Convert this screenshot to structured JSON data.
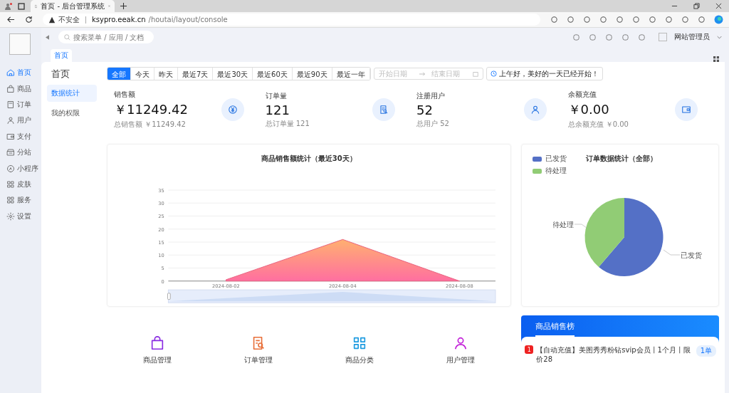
{
  "browser": {
    "tab_title": "首页 - 后台管理系统",
    "security": "不安全",
    "host": "ksypro.eeak.cn",
    "path": "/houtai/layout/console"
  },
  "header": {
    "search_placeholder": "搜索菜单 / 应用 / 文档",
    "user": "网站管理员"
  },
  "page_tabs": [
    {
      "label": "首页",
      "selected": true
    }
  ],
  "sidebar": [
    {
      "label": "首页",
      "kind": "home",
      "selected": true
    },
    {
      "label": "商品",
      "kind": "bag",
      "selected": false
    },
    {
      "label": "订单",
      "kind": "doc",
      "selected": false
    },
    {
      "label": "用户",
      "kind": "user",
      "selected": false
    },
    {
      "label": "支付",
      "kind": "wallet",
      "selected": false
    },
    {
      "label": "分站",
      "kind": "store",
      "selected": false
    },
    {
      "label": "小程序",
      "kind": "mini",
      "selected": false
    },
    {
      "label": "皮肤",
      "kind": "grid",
      "selected": false
    },
    {
      "label": "服务",
      "kind": "grid",
      "selected": false
    },
    {
      "label": "设置",
      "kind": "gear",
      "selected": false
    }
  ],
  "page_title": "首页",
  "submenu": [
    {
      "label": "数据统计",
      "selected": true
    },
    {
      "label": "我的权限",
      "selected": false
    }
  ],
  "filters": [
    {
      "label": "全部",
      "selected": true
    },
    {
      "label": "今天",
      "selected": false
    },
    {
      "label": "昨天",
      "selected": false
    },
    {
      "label": "最近7天",
      "selected": false
    },
    {
      "label": "最近30天",
      "selected": false
    },
    {
      "label": "最近60天",
      "selected": false
    },
    {
      "label": "最近90天",
      "selected": false
    },
    {
      "label": "最近一年",
      "selected": false
    }
  ],
  "date_range": {
    "start_placeholder": "开始日期",
    "end_placeholder": "结束日期"
  },
  "greeting": "上午好，美好的一天已经开始！",
  "stats": [
    {
      "label": "销售额",
      "value": "￥11249.42",
      "sub": "总销售额 ￥11249.42",
      "kind": "yen"
    },
    {
      "label": "订单量",
      "value": "121",
      "sub": "总订单量 121",
      "kind": "order"
    },
    {
      "label": "注册用户",
      "value": "52",
      "sub": "总用户 52",
      "kind": "user"
    },
    {
      "label": "余额充值",
      "value": "￥0.00",
      "sub": "总余额充值 ￥0.00",
      "kind": "wallet"
    }
  ],
  "sales_chart": {
    "chart_data": {
      "type": "area",
      "title": "商品销售额统计（最近30天）",
      "categories": [
        "2024-08-02",
        "2024-08-04",
        "2024-08-08"
      ],
      "series": [
        {
          "color": "#e8607f",
          "values": [
            0.5,
            16,
            0
          ]
        }
      ],
      "grid": true,
      "ylim": [
        0,
        35
      ],
      "yticks": [
        0,
        5,
        10,
        15,
        20,
        25,
        30,
        35
      ]
    }
  },
  "order_chart": {
    "title": "订单数据统计（全部）",
    "legend": [
      {
        "label": "已发货",
        "color": "#5470c6"
      },
      {
        "label": "待处理",
        "color": "#91cc75"
      }
    ],
    "slice_labels": [
      "已发货",
      "待处理"
    ]
  },
  "quick_links": [
    {
      "label": "商品管理",
      "kind": "bag",
      "color": "#8a2be2"
    },
    {
      "label": "订单管理",
      "kind": "order",
      "color": "#e8703a"
    },
    {
      "label": "商品分类",
      "kind": "grid",
      "color": "#1e9be0"
    },
    {
      "label": "用户管理",
      "kind": "user",
      "color": "#c21fd8"
    }
  ],
  "ranking": {
    "title": "商品销售榜",
    "items": [
      {
        "rank": "1",
        "text": "【自动充值】美图秀秀粉钻svip会员丨1个月丨限价28",
        "count": "1单"
      }
    ]
  }
}
